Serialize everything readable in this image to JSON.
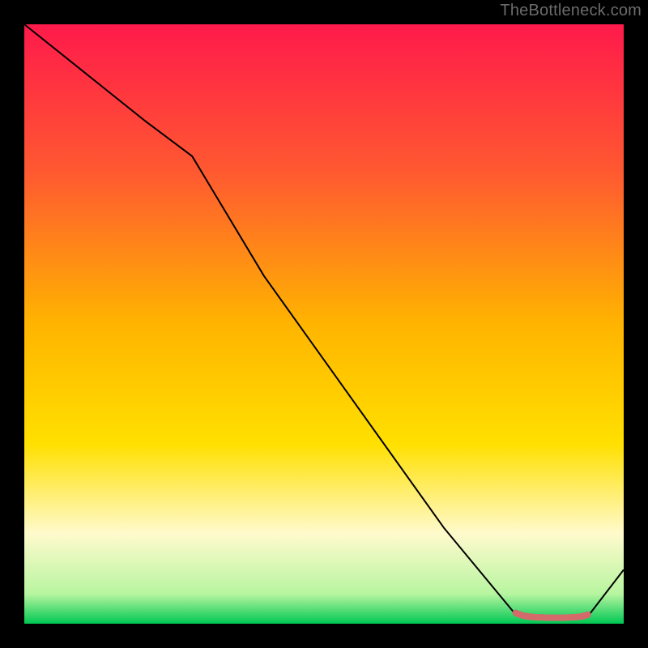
{
  "attribution": "TheBottleneck.com",
  "chart_data": {
    "type": "line",
    "title": "",
    "xlabel": "",
    "ylabel": "",
    "xlim": [
      0,
      100
    ],
    "ylim": [
      0,
      100
    ],
    "grid": false,
    "legend": false,
    "background": {
      "style": "vertical-gradient",
      "stops": [
        {
          "offset": 0.0,
          "color": "#ff1a4b"
        },
        {
          "offset": 0.25,
          "color": "#ff5a30"
        },
        {
          "offset": 0.5,
          "color": "#ffb400"
        },
        {
          "offset": 0.7,
          "color": "#ffe000"
        },
        {
          "offset": 0.85,
          "color": "#fffacd"
        },
        {
          "offset": 0.95,
          "color": "#b8f5a0"
        },
        {
          "offset": 1.0,
          "color": "#00c853"
        }
      ]
    },
    "series": [
      {
        "name": "main-curve",
        "type": "line",
        "stroke": "#000000",
        "stroke_width": 2,
        "x": [
          0,
          10,
          20,
          28,
          40,
          55,
          70,
          82,
          84,
          86,
          88,
          90,
          92,
          94,
          100
        ],
        "y": [
          100,
          92,
          84,
          78,
          58,
          37,
          16,
          1.5,
          1.2,
          1.0,
          1.0,
          1.0,
          1.0,
          1.2,
          9
        ]
      },
      {
        "name": "highlight-segment",
        "type": "line",
        "stroke": "#d46a6a",
        "stroke_width": 8,
        "x": [
          82,
          83,
          84,
          85,
          87.5,
          90,
          92,
          93,
          94
        ],
        "y": [
          1.8,
          1.4,
          1.2,
          1.1,
          1.0,
          1.0,
          1.1,
          1.2,
          1.5
        ]
      }
    ]
  }
}
